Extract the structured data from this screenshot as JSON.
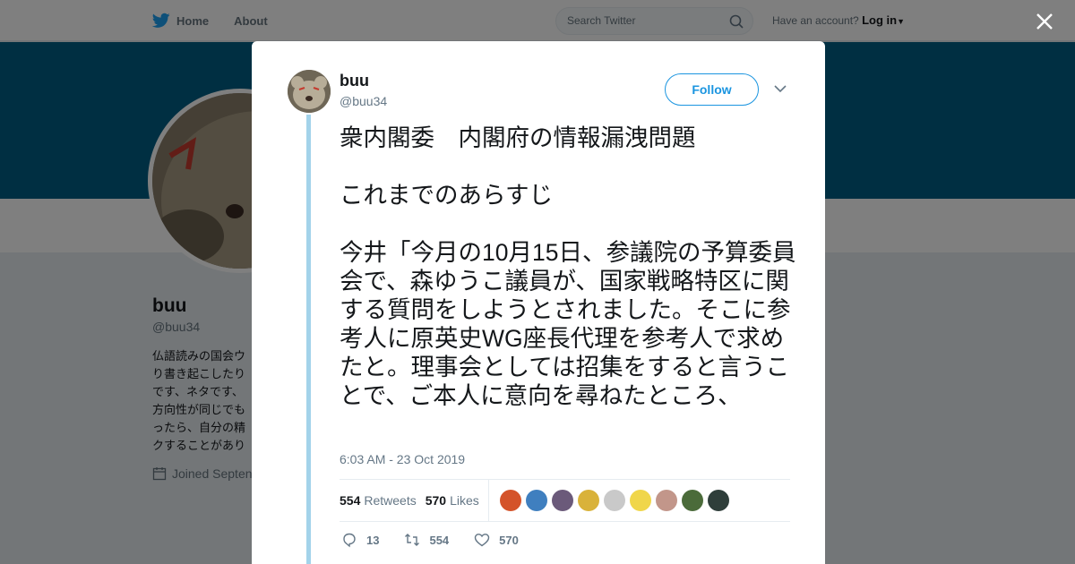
{
  "nav": {
    "home_label": "Home",
    "about_label": "About",
    "search_placeholder": "Search Twitter",
    "have_account": "Have an account?",
    "login_label": "Log in"
  },
  "profile": {
    "name": "buu",
    "handle": "@buu34",
    "bio": "仏語読みの国会ウ\nり書き起こしたり\nです、ネタです、\n方向性が同じでも\nったら、自分の精\nクすることがあり",
    "joined": "Joined Septen"
  },
  "tweet": {
    "author_name": "buu",
    "author_handle": "@buu34",
    "follow_label": "Follow",
    "text": "衆内閣委　内閣府の情報漏洩問題\n\nこれまでのあらすじ\n\n今井「今月の10月15日、参議院の予算委員会で、森ゆうこ議員が、国家戦略特区に関する質問をしようとされました。そこに参考人に原英史WG座長代理を参考人で求めたと。理事会としては招集をすると言うことで、ご本人に意向を尋ねたところ、",
    "timestamp": "6:03 AM - 23 Oct 2019",
    "retweets_count": "554",
    "retweets_label": "Retweets",
    "likes_count": "570",
    "likes_label": "Likes",
    "reply_count": "13",
    "retweet_action_count": "554",
    "like_action_count": "570"
  },
  "colors": {
    "banner": "#005f85",
    "link_blue": "#1b95e0",
    "thread_line": "#a3d3ea"
  },
  "liker_avatar_colors": [
    "#d4532a",
    "#3f7fbf",
    "#6b5a7a",
    "#d9b23a",
    "#c9c9c9",
    "#f0d64a",
    "#c2968a",
    "#4b6b3a",
    "#2f3e3a"
  ]
}
